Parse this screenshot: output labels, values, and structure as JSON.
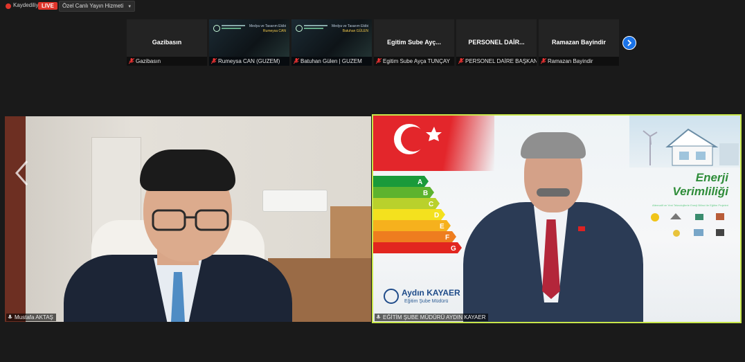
{
  "topbar": {
    "recording_label": "Kaydediliyor",
    "live_badge": "LIVE",
    "stream_service": "Özel Canlı Yayın Hizmeti"
  },
  "strip": {
    "participants": [
      {
        "tile_name": "Gazibasın",
        "caption": "Gazibasın",
        "kind": "name"
      },
      {
        "caption": "Rumeysa CAN (GUZEM)",
        "kind": "slide",
        "slide_title": "Medya ve Tasarım Ekibi",
        "slide_name": "Rumeysa CAN"
      },
      {
        "caption": "Batuhan Gülen | GUZEM",
        "kind": "slide",
        "slide_title": "Medya ve Tasarım Ekibi",
        "slide_name": "Batuhan GÜLEN"
      },
      {
        "tile_name": "Egitim Sube Ayç...",
        "caption": "Egitim Sube Ayça TUNÇAY",
        "kind": "name"
      },
      {
        "tile_name": "PERSONEL DAİR...",
        "caption": "PERSONEL DAİRE BAŞKANI",
        "kind": "name"
      },
      {
        "tile_name": "Ramazan Bayindir",
        "caption": "Ramazan Bayindir",
        "kind": "name"
      }
    ]
  },
  "main": {
    "left_caption": "Mustafa AKTAŞ",
    "right_caption": "EĞİTİM ŞUBE MÜDÜRÜ AYDIN KAYAER",
    "slide": {
      "energy_title_1": "Enerji",
      "energy_title_2": "Verimliliği",
      "energy_subtitle": "Alternatif ve Yeni Teknolojilerle Enerji Bilinci ile Eğitim Projeleri",
      "energy_classes": [
        "A",
        "B",
        "C",
        "D",
        "E",
        "F",
        "G"
      ],
      "presenter_name": "Aydın KAYAER",
      "presenter_role": "Eğitim Şube Müdürü"
    }
  },
  "colors": {
    "live_red": "#e0352b",
    "active_speaker_border": "#c8e64a",
    "next_button": "#1a73e8"
  }
}
